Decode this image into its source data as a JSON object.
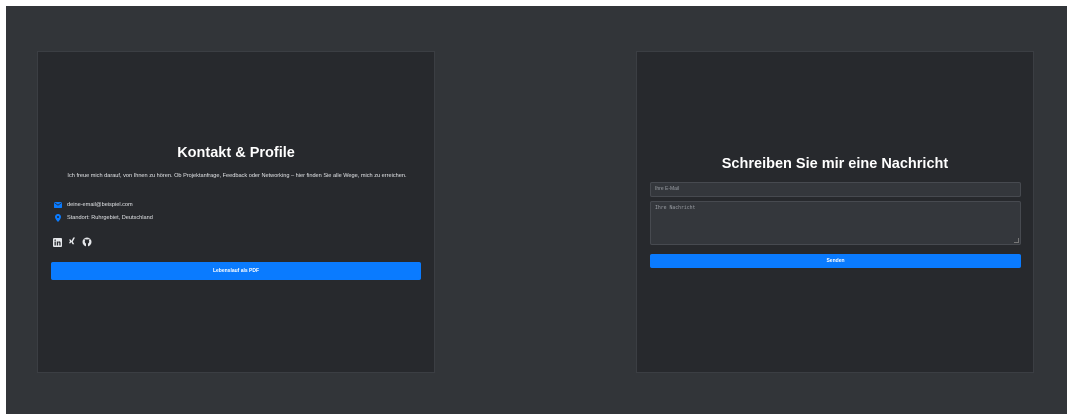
{
  "contact": {
    "title": "Kontakt & Profile",
    "intro": "Ich freue mich darauf, von Ihnen zu hören. Ob Projektanfrage, Feedback oder Networking – hier finden Sie alle Wege, mich zu erreichen.",
    "email": "deine-email@beispiel.com",
    "location": "Standort: Ruhrgebiet, Deutschland",
    "email_icon": "envelope-icon",
    "location_icon": "map-pin-icon",
    "social_icons": [
      "linkedin-icon",
      "xing-icon",
      "github-icon"
    ],
    "cv_button": "Lebenslauf als PDF"
  },
  "message_form": {
    "title": "Schreiben Sie mir eine Nachricht",
    "email_placeholder": "Ihre E-Mail",
    "message_placeholder": "Ihre Nachricht",
    "send_button": "Senden"
  },
  "colors": {
    "page_background": "#323539",
    "card_background": "#27292d",
    "accent": "#0a7bff"
  }
}
